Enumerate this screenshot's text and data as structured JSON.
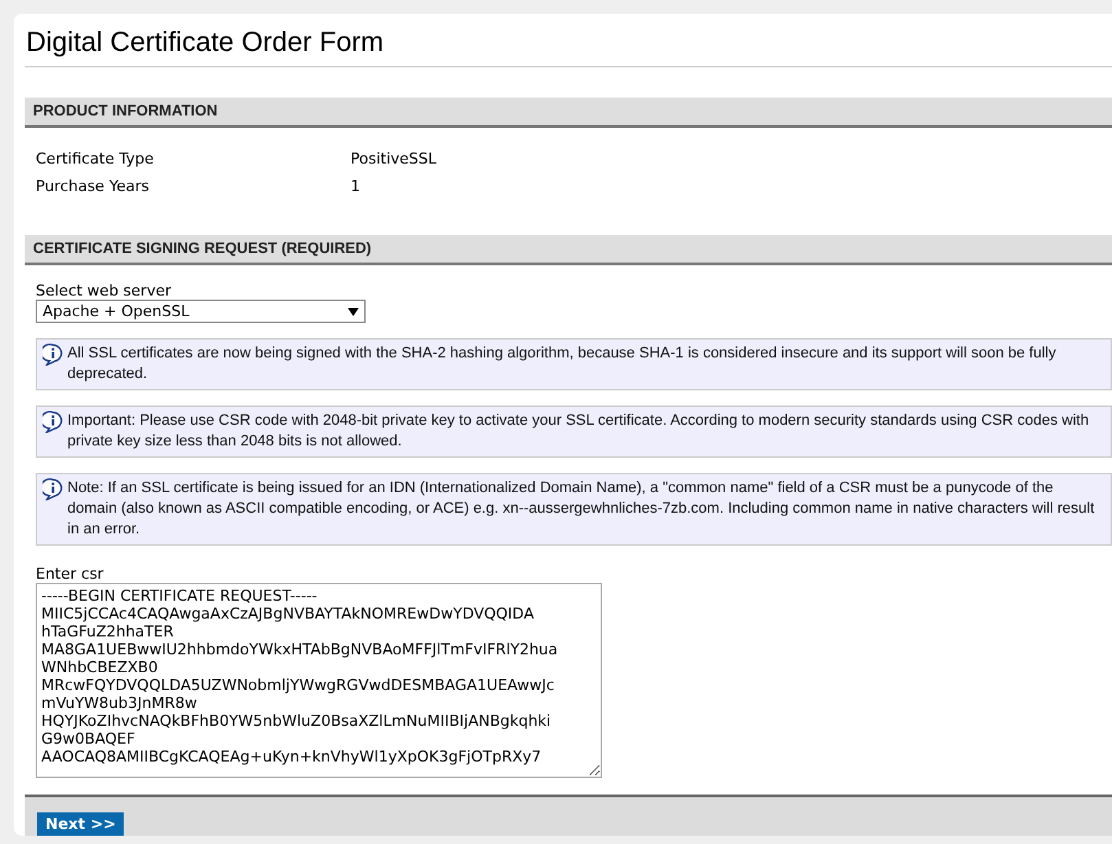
{
  "title": "Digital Certificate Order Form",
  "sections": [
    {
      "heading": "PRODUCT INFORMATION"
    },
    {
      "heading": "CERTIFICATE SIGNING REQUEST (REQUIRED)"
    }
  ],
  "product_info": [
    {
      "label": "Certificate Type",
      "value": "PositiveSSL"
    },
    {
      "label": "Purchase Years",
      "value": "1"
    }
  ],
  "web_server": {
    "label": "Select web server",
    "value": "Apache + OpenSSL"
  },
  "notices": [
    "All SSL certificates are now being signed with the SHA-2 hashing algorithm, because SHA-1 is considered insecure and its support will soon be fully deprecated.",
    "Important: Please use CSR code with 2048-bit private key to activate your SSL certificate. According to modern security standards using CSR codes with private key size less than 2048 bits is not allowed.",
    "Note: If an SSL certificate is being issued for an IDN (Internationalized Domain Name), a \"common name\" field of a CSR must be a punycode of the domain (also known as ASCII compatible encoding, or ACE) e.g. xn--aussergewhnliches-7zb.com. Including common name in native characters will result in an error."
  ],
  "csr": {
    "label": "Enter csr",
    "lines": [
      "-----BEGIN CERTIFICATE REQUEST-----",
      "MIIC5jCCAc4CAQAwgaAxCzAJBgNVBAYTAkNOMREwDwYDVQQIDA",
      "hTaGFuZ2hhaTER",
      "MA8GA1UEBwwIU2hhbmdoYWkxHTAbBgNVBAoMFFJlTmFvIFRlY2hua",
      "WNhbCBEZXB0",
      "MRcwFQYDVQQLDA5UZWNobmljYWwgRGVwdDESMBAGA1UEAwwJc",
      "mVuYW8ub3JnMR8w",
      "HQYJKoZIhvcNAQkBFhB0YW5nbWluZ0BsaXZlLmNuMIIBIjANBgkqhki",
      "G9w0BAQEF",
      "AAOCAQ8AMIIBCgKCAQEAg+uKyn+knVhyWl1yXpOK3gFjOTpRXy7"
    ]
  },
  "next_button": "Next >>"
}
